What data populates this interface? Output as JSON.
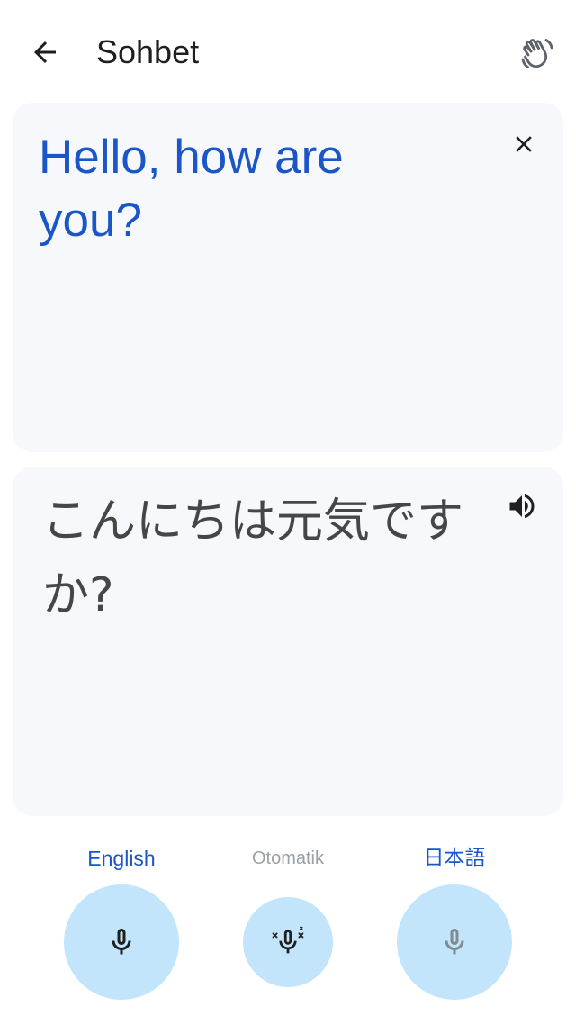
{
  "header": {
    "title": "Sohbet",
    "back_icon": "arrow-back-icon",
    "right_icon": "waving-hand-icon"
  },
  "source_card": {
    "text": "Hello, how are you?",
    "text_color": "#1a56c8",
    "action_icon": "close-icon"
  },
  "target_card": {
    "text": "こんにちは元気ですか?",
    "action_icon": "volume-up-icon"
  },
  "controls": {
    "left_language": "English",
    "center_mode": "Otomatik",
    "right_language": "日本語",
    "accent_color": "#1a56c8",
    "mic_background": "#c2e5fb",
    "left_mic_icon": "microphone-icon",
    "center_mic_icon": "auto-microphone-icon",
    "right_mic_icon": "microphone-icon"
  }
}
